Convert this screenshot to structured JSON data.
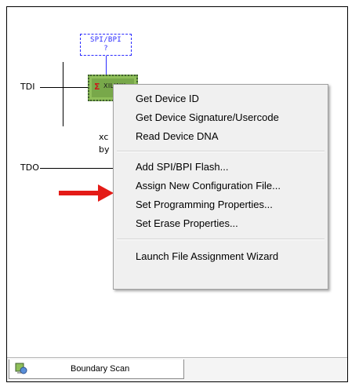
{
  "diagram": {
    "tdi_label": "TDI",
    "tdo_label": "TDO",
    "spi_box_label": "SPI/BPI",
    "spi_box_status": "?",
    "chip_label": "XILINX",
    "device_name_fragment": "xc",
    "device_file_fragment": "by"
  },
  "context_menu": {
    "items": [
      {
        "label": "Get Device ID"
      },
      {
        "label": "Get Device Signature/Usercode"
      },
      {
        "label": "Read Device DNA"
      },
      {
        "label": "Add SPI/BPI Flash..."
      },
      {
        "label": "Assign New Configuration File..."
      },
      {
        "label": "Set Programming Properties..."
      },
      {
        "label": "Set Erase Properties..."
      },
      {
        "label": "Launch File Assignment Wizard"
      }
    ]
  },
  "annotation": {
    "arrow_color": "#e41b17"
  },
  "tabs": [
    {
      "label": "Boundary Scan",
      "icon": "boundary-scan-icon"
    }
  ],
  "colors": {
    "chip_green": "#78a84a",
    "spi_blue": "#2b2bff",
    "menu_bg": "#f0f0f0"
  }
}
